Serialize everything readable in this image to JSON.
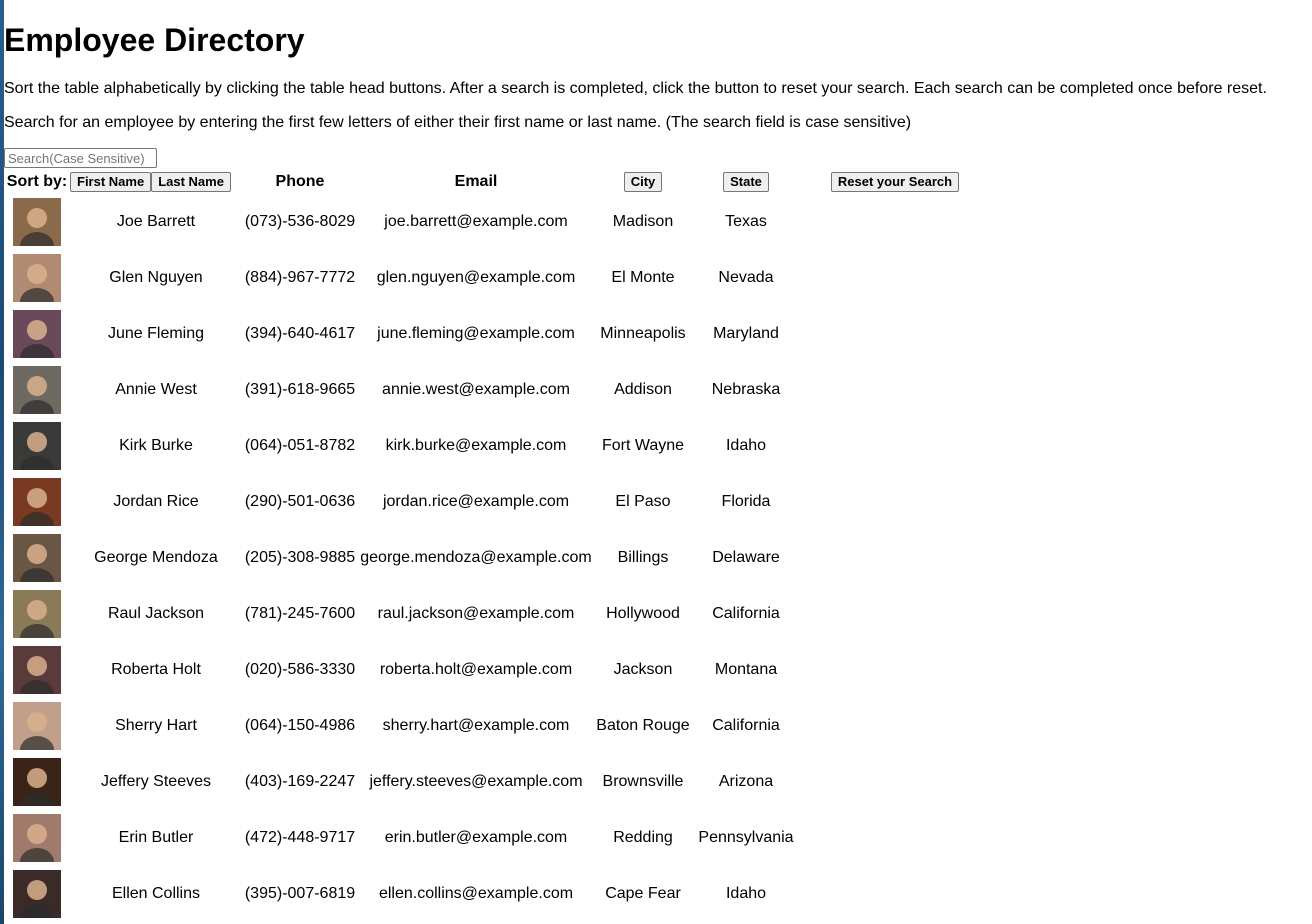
{
  "title": "Employee Directory",
  "instructions": [
    "Sort the table alphabetically by clicking the table head buttons. After a search is completed, click the button to reset your search. Each search can be completed once before reset.",
    "Search for an employee by entering the first few letters of either their first name or last name. (The search field is case sensitive)"
  ],
  "search": {
    "placeholder": "Search(Case Sensitive)",
    "value": ""
  },
  "table": {
    "sort_by_label": "Sort by:",
    "first_name_button": "First Name",
    "last_name_button": "Last Name",
    "phone_header": "Phone",
    "email_header": "Email",
    "city_button": "City",
    "state_button": "State",
    "reset_button": "Reset your Search"
  },
  "employees": [
    {
      "name": "Joe Barrett",
      "phone": "(073)-536-8029",
      "email": "joe.barrett@example.com",
      "city": "Madison",
      "state": "Texas",
      "avatar_color": "#8a6a4a",
      "avatar_icon": "person-photo"
    },
    {
      "name": "Glen Nguyen",
      "phone": "(884)-967-7772",
      "email": "glen.nguyen@example.com",
      "city": "El Monte",
      "state": "Nevada",
      "avatar_color": "#b08a72",
      "avatar_icon": "person-photo"
    },
    {
      "name": "June Fleming",
      "phone": "(394)-640-4617",
      "email": "june.fleming@example.com",
      "city": "Minneapolis",
      "state": "Maryland",
      "avatar_color": "#6a4a5a",
      "avatar_icon": "person-photo"
    },
    {
      "name": "Annie West",
      "phone": "(391)-618-9665",
      "email": "annie.west@example.com",
      "city": "Addison",
      "state": "Nebraska",
      "avatar_color": "#6e6a62",
      "avatar_icon": "person-photo"
    },
    {
      "name": "Kirk Burke",
      "phone": "(064)-051-8782",
      "email": "kirk.burke@example.com",
      "city": "Fort Wayne",
      "state": "Idaho",
      "avatar_color": "#3a3a38",
      "avatar_icon": "person-photo"
    },
    {
      "name": "Jordan Rice",
      "phone": "(290)-501-0636",
      "email": "jordan.rice@example.com",
      "city": "El Paso",
      "state": "Florida",
      "avatar_color": "#7a3a22",
      "avatar_icon": "person-photo"
    },
    {
      "name": "George Mendoza",
      "phone": "(205)-308-9885",
      "email": "george.mendoza@example.com",
      "city": "Billings",
      "state": "Delaware",
      "avatar_color": "#6a5644",
      "avatar_icon": "person-photo"
    },
    {
      "name": "Raul Jackson",
      "phone": "(781)-245-7600",
      "email": "raul.jackson@example.com",
      "city": "Hollywood",
      "state": "California",
      "avatar_color": "#8a7a58",
      "avatar_icon": "person-photo"
    },
    {
      "name": "Roberta Holt",
      "phone": "(020)-586-3330",
      "email": "roberta.holt@example.com",
      "city": "Jackson",
      "state": "Montana",
      "avatar_color": "#5a3a3a",
      "avatar_icon": "person-photo"
    },
    {
      "name": "Sherry Hart",
      "phone": "(064)-150-4986",
      "email": "sherry.hart@example.com",
      "city": "Baton Rouge",
      "state": "California",
      "avatar_color": "#c0a08a",
      "avatar_icon": "person-photo"
    },
    {
      "name": "Jeffery Steeves",
      "phone": "(403)-169-2247",
      "email": "jeffery.steeves@example.com",
      "city": "Brownsville",
      "state": "Arizona",
      "avatar_color": "#3a2418",
      "avatar_icon": "person-photo"
    },
    {
      "name": "Erin Butler",
      "phone": "(472)-448-9717",
      "email": "erin.butler@example.com",
      "city": "Redding",
      "state": "Pennsylvania",
      "avatar_color": "#a07a6a",
      "avatar_icon": "person-photo"
    },
    {
      "name": "Ellen Collins",
      "phone": "(395)-007-6819",
      "email": "ellen.collins@example.com",
      "city": "Cape Fear",
      "state": "Idaho",
      "avatar_color": "#3a2a28",
      "avatar_icon": "person-photo"
    }
  ]
}
